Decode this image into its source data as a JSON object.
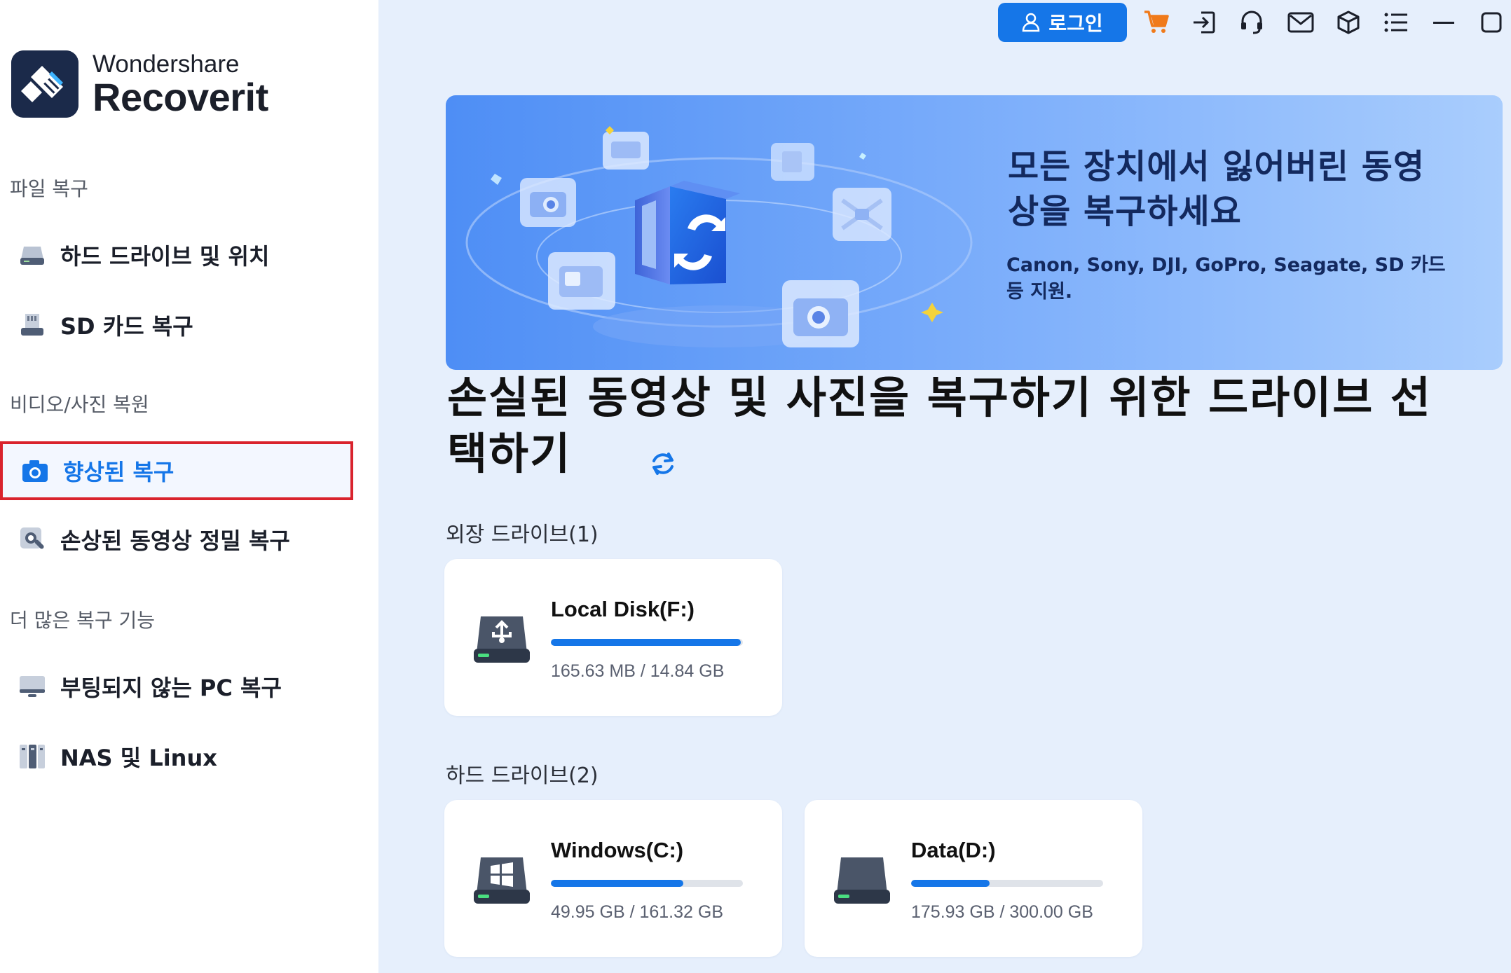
{
  "brand": {
    "top": "Wondershare",
    "bottom": "Recoverit"
  },
  "sidebar": {
    "sections": [
      {
        "label": "파일 복구"
      },
      {
        "label": "비디오/사진 복원"
      },
      {
        "label": "더 많은 복구 기능"
      }
    ],
    "items": [
      {
        "label": "하드 드라이브 및 위치",
        "icon": "hard-drive-icon"
      },
      {
        "label": "SD 카드 복구",
        "icon": "sd-card-icon"
      },
      {
        "label": "향상된 복구",
        "icon": "camera-icon",
        "active": true
      },
      {
        "label": "손상된 동영상 정밀 복구",
        "icon": "video-repair-icon"
      },
      {
        "label": "부팅되지 않는 PC 복구",
        "icon": "monitor-icon"
      },
      {
        "label": "NAS 및 Linux",
        "icon": "nas-icon"
      }
    ]
  },
  "toolbar": {
    "login_label": "로그인",
    "icons": [
      "cart-icon",
      "sign-in-icon",
      "headset-icon",
      "mail-icon",
      "box-icon",
      "menu-icon",
      "minimize-icon",
      "maximize-icon"
    ]
  },
  "banner": {
    "title": "모든 장치에서 잃어버린 동영상을 복구하세요",
    "subtitle": "Canon, Sony, DJI, GoPro, Seagate, SD 카드 등 지원."
  },
  "main": {
    "title": "손실된 동영상 및 사진을 복구하기 위한 드라이브 선택하기",
    "groups": [
      {
        "label": "외장 드라이브(1)",
        "drives": [
          {
            "name": "Local Disk(F:)",
            "size": "165.63 MB / 14.84 GB",
            "usage": 0.99,
            "icon": "usb-drive-icon"
          }
        ]
      },
      {
        "label": "하드 드라이브(2)",
        "drives": [
          {
            "name": "Windows(C:)",
            "size": "49.95 GB / 161.32 GB",
            "usage": 0.69,
            "icon": "windows-drive-icon"
          },
          {
            "name": "Data(D:)",
            "size": "175.93 GB / 300.00 GB",
            "usage": 0.41,
            "icon": "hard-drive-icon"
          }
        ]
      }
    ]
  },
  "colors": {
    "accent": "#1576e8",
    "highlight": "#d9232d",
    "background": "#e6effc"
  }
}
